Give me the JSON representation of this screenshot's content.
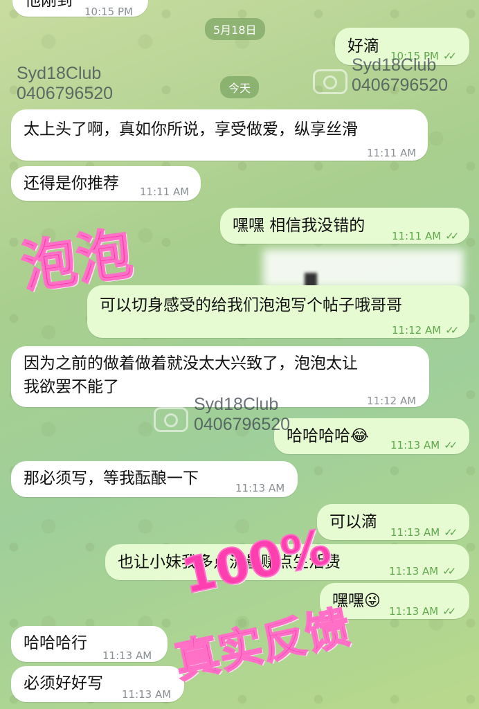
{
  "top_partial": {
    "text": "他刚到",
    "time": "10:15 PM"
  },
  "date_separators": {
    "may18": "5月18日",
    "today": "今天"
  },
  "messages": [
    {
      "text": "好滴",
      "time": "10:15 PM"
    },
    {
      "text": "太上头了啊，真如你所说，享受做爱，纵享丝滑",
      "time": "11:11 AM"
    },
    {
      "text": "还得是你推荐",
      "time": "11:11 AM"
    },
    {
      "text": "嘿嘿 相信我没错的",
      "time": "11:11 AM"
    },
    {
      "text": "可以切身感受的给我们泡泡写个帖子哦哥哥",
      "time": "11:12 AM"
    },
    {
      "text": "因为之前的做着做着就没太大兴致了，泡泡太让\n我欲罢不能了",
      "time": "11:12 AM"
    },
    {
      "text": "哈哈哈哈😂",
      "time": "11:13 AM"
    },
    {
      "text": "那必须写，等我酝酿一下",
      "time": "11:13 AM"
    },
    {
      "text": "可以滴",
      "time": "11:13 AM"
    },
    {
      "text": "也让小妹我多点流量赚点生活费",
      "time": "11:13 AM"
    },
    {
      "text": "嘿嘿😜",
      "time": "11:13 AM"
    },
    {
      "text": "哈哈哈行",
      "time": "11:13 AM"
    },
    {
      "text": "必须好好写",
      "time": "11:13 AM"
    }
  ],
  "read_check": "✓✓",
  "watermarks": {
    "line1": "Syd18Club",
    "line2": "0406796520"
  },
  "overlays": {
    "paopao": "泡泡",
    "percent": "100%",
    "feedback": "真实反馈"
  },
  "colors": {
    "incoming": "#ffffff",
    "outgoing": "#e7fbd3",
    "check": "#5fa84c",
    "stamp": "#ff3fb0"
  }
}
